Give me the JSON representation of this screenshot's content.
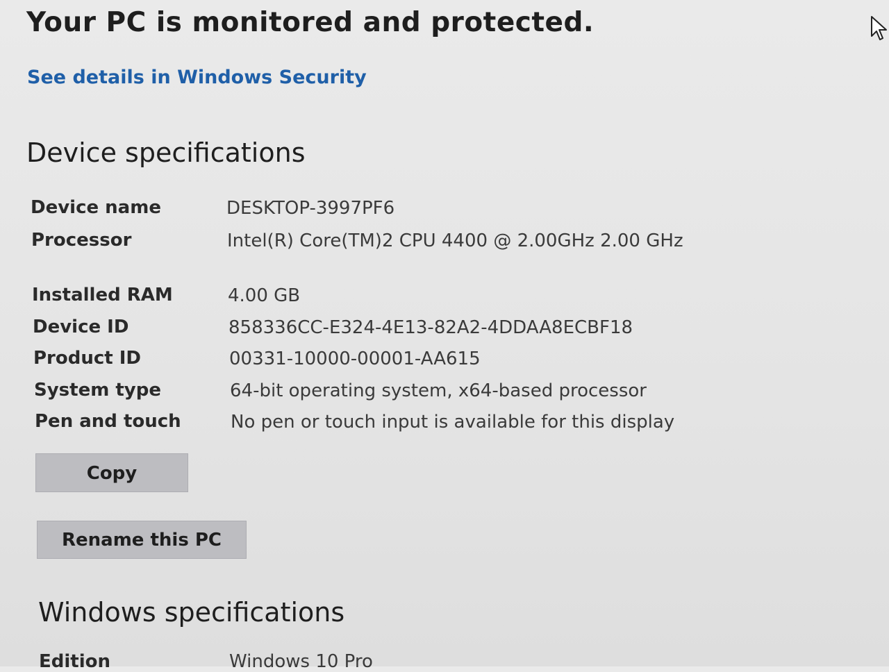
{
  "status": {
    "heading": "Your PC is monitored and protected.",
    "link": "See details in Windows Security"
  },
  "device_specs": {
    "heading": "Device specifications",
    "rows": [
      {
        "label": "Device name",
        "value": "DESKTOP-3997PF6"
      },
      {
        "label": "Processor",
        "value": "Intel(R) Core(TM)2 CPU          4400  @ 2.00GHz   2.00 GHz"
      },
      {
        "label": "Installed RAM",
        "value": "4.00 GB"
      },
      {
        "label": "Device ID",
        "value": "858336CC-E324-4E13-82A2-4DDAA8ECBF18"
      },
      {
        "label": "Product ID",
        "value": "00331-10000-00001-AA615"
      },
      {
        "label": "System type",
        "value": "64-bit operating system, x64-based processor"
      },
      {
        "label": "Pen and touch",
        "value": "No pen or touch input is available for this display"
      }
    ],
    "copy_label": "Copy",
    "rename_label": "Rename this PC"
  },
  "windows_specs": {
    "heading": "Windows specifications",
    "rows": [
      {
        "label": "Edition",
        "value": "Windows 10 Pro"
      }
    ]
  },
  "icons": {
    "cursor": "mouse-pointer-icon"
  },
  "colors": {
    "link": "#1f5fa8",
    "button": "#bdbdc1",
    "background": "#e6e6e6"
  }
}
